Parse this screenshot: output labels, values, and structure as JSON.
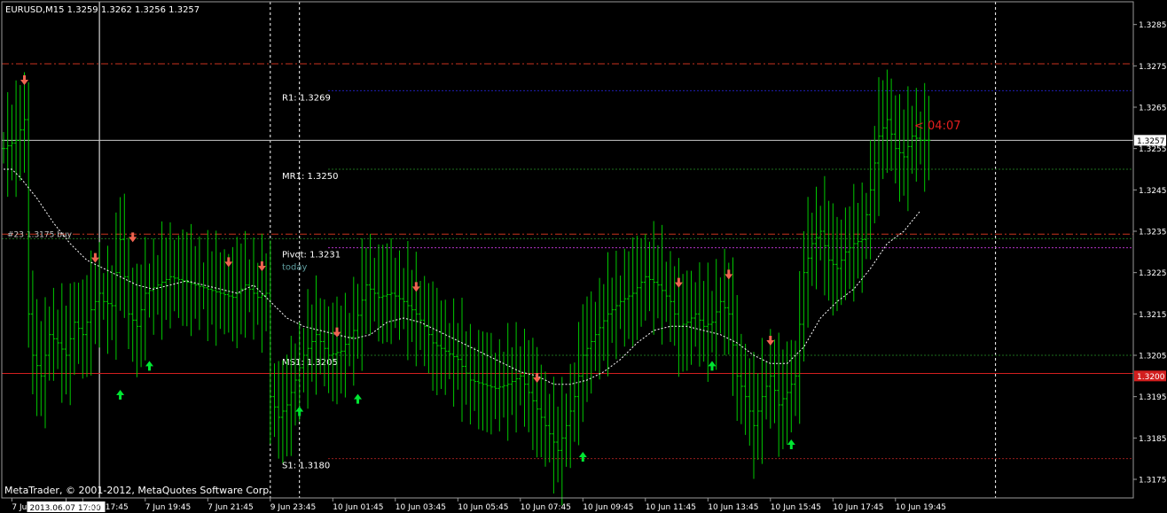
{
  "header": {
    "symbol_info": "EURUSD,M15  1.3259 1.3262 1.3256 1.3257"
  },
  "copyright": "MetaTrader, © 2001-2012, MetaQuotes Software Corp.",
  "timer": "< 04:07",
  "colors": {
    "background": "#000000",
    "bar": "#00c800",
    "ma": "#ffffff",
    "price_line": "#c8c8c8",
    "bid_label_bg": "#ffffff",
    "support_line": "#d21e1e",
    "resistance_dashdot": "#c8321e",
    "pivot_dot": "#b432c8",
    "green_dot": "#1e6e1e",
    "r1_dot": "#1e1eb4",
    "s1_dot": "#961e1e",
    "arrow_up": "#00e632",
    "arrow_down": "#f06450",
    "timer_text": "#e61e1e",
    "label_text": "#ffffff",
    "today_text": "#5f9ea0",
    "axis_text": "#ffffff"
  },
  "chart_data": {
    "type": "bar",
    "symbol": "EURUSD",
    "timeframe": "M15",
    "ylim": [
      1.31705,
      1.32905
    ],
    "y_ticks": [
      "1.3285",
      "1.3275",
      "1.3265",
      "1.3255",
      "1.3245",
      "1.3235",
      "1.3225",
      "1.3215",
      "1.3205",
      "1.3195",
      "1.3185",
      "1.3175"
    ],
    "current_price": "1.3257",
    "price_marker": "1.3200",
    "x_labels": [
      {
        "text": "7 Jun 2013",
        "i": 2
      },
      {
        "text": "2013.06.07 17:00",
        "i": 15,
        "highlight": true
      },
      {
        "text": "7 Jun 17:45",
        "i": 19
      },
      {
        "text": "7 Jun 19:45",
        "i": 34
      },
      {
        "text": "7 Jun 21:45",
        "i": 49
      },
      {
        "text": "9 Jun 23:45",
        "i": 64
      },
      {
        "text": "10 Jun 01:45",
        "i": 79
      },
      {
        "text": "10 Jun 03:45",
        "i": 94
      },
      {
        "text": "10 Jun 05:45",
        "i": 109
      },
      {
        "text": "10 Jun 07:45",
        "i": 124
      },
      {
        "text": "10 Jun 09:45",
        "i": 139
      },
      {
        "text": "10 Jun 11:45",
        "i": 154
      },
      {
        "text": "10 Jun 13:45",
        "i": 169
      },
      {
        "text": "10 Jun 15:45",
        "i": 184
      },
      {
        "text": "10 Jun 17:45",
        "i": 199
      },
      {
        "text": "10 Jun 19:45",
        "i": 214
      }
    ],
    "levels": [
      {
        "name": "R1",
        "text": "R1: 1.3269",
        "price": 1.3269,
        "style": "dot",
        "color": "#1e1eb4"
      },
      {
        "name": "MR1",
        "text": "MR1: 1.3250",
        "price": 1.325,
        "style": "dot",
        "color": "#1e6e1e"
      },
      {
        "name": "Pivot",
        "text": "Pivot: 1.3231",
        "price": 1.3231,
        "style": "dot",
        "color": "#b432c8"
      },
      {
        "name": "MS1",
        "text": "MS1: 1.3205",
        "price": 1.3205,
        "style": "dot",
        "color": "#1e6e1e"
      },
      {
        "name": "S1",
        "text": "S1: 1.3180",
        "price": 1.318,
        "style": "dot",
        "color": "#961e1e"
      }
    ],
    "today_label": "today",
    "hlines": [
      {
        "price": 1.32755,
        "style": "dashdot",
        "color": "#c8321e"
      },
      {
        "price": 1.32343,
        "style": "dashdot",
        "color": "#c8321e"
      },
      {
        "price": 1.32332,
        "style": "dot",
        "color": "#1e6e1e"
      },
      {
        "price": 1.32006,
        "style": "solid",
        "color": "#d21e1e"
      }
    ],
    "order_label": "#23 1.3175 buy",
    "vlines": [
      {
        "i": 23,
        "style": "solid"
      },
      {
        "i": 64,
        "style": "dash"
      },
      {
        "i": 71,
        "style": "dash"
      },
      {
        "i": 238,
        "style": "dash"
      }
    ],
    "arrows_down": [
      {
        "i": 5,
        "price": 1.3271
      },
      {
        "i": 22,
        "price": 1.3228
      },
      {
        "i": 31,
        "price": 1.3233
      },
      {
        "i": 54,
        "price": 1.3227
      },
      {
        "i": 62,
        "price": 1.3226
      },
      {
        "i": 80,
        "price": 1.321
      },
      {
        "i": 99,
        "price": 1.3221
      },
      {
        "i": 128,
        "price": 1.3199
      },
      {
        "i": 162,
        "price": 1.3222
      },
      {
        "i": 174,
        "price": 1.3224
      },
      {
        "i": 184,
        "price": 1.3208
      }
    ],
    "arrows_up": [
      {
        "i": 28,
        "price": 1.3196
      },
      {
        "i": 35,
        "price": 1.3203
      },
      {
        "i": 71,
        "price": 1.3192
      },
      {
        "i": 85,
        "price": 1.3195
      },
      {
        "i": 139,
        "price": 1.3181
      },
      {
        "i": 170,
        "price": 1.3203
      },
      {
        "i": 189,
        "price": 1.3184
      }
    ],
    "ma_anchors": [
      [
        0,
        1.325
      ],
      [
        2,
        1.325
      ],
      [
        4,
        1.3248
      ],
      [
        8,
        1.3243
      ],
      [
        12,
        1.3237
      ],
      [
        16,
        1.3232
      ],
      [
        20,
        1.3228
      ],
      [
        24,
        1.3226
      ],
      [
        28,
        1.3224
      ],
      [
        32,
        1.3222
      ],
      [
        36,
        1.3221
      ],
      [
        40,
        1.3222
      ],
      [
        44,
        1.3223
      ],
      [
        48,
        1.3222
      ],
      [
        52,
        1.3221
      ],
      [
        56,
        1.322
      ],
      [
        60,
        1.3222
      ],
      [
        64,
        1.3218
      ],
      [
        68,
        1.3214
      ],
      [
        72,
        1.3212
      ],
      [
        76,
        1.3211
      ],
      [
        80,
        1.321
      ],
      [
        84,
        1.3209
      ],
      [
        88,
        1.321
      ],
      [
        92,
        1.3213
      ],
      [
        96,
        1.3214
      ],
      [
        100,
        1.3213
      ],
      [
        104,
        1.3211
      ],
      [
        108,
        1.3209
      ],
      [
        112,
        1.3207
      ],
      [
        116,
        1.3205
      ],
      [
        120,
        1.3203
      ],
      [
        124,
        1.3201
      ],
      [
        128,
        1.32
      ],
      [
        132,
        1.3198
      ],
      [
        136,
        1.3198
      ],
      [
        140,
        1.3199
      ],
      [
        144,
        1.3201
      ],
      [
        148,
        1.3204
      ],
      [
        152,
        1.3208
      ],
      [
        156,
        1.3211
      ],
      [
        160,
        1.3212
      ],
      [
        164,
        1.3212
      ],
      [
        168,
        1.3211
      ],
      [
        172,
        1.321
      ],
      [
        176,
        1.3208
      ],
      [
        180,
        1.3205
      ],
      [
        184,
        1.3203
      ],
      [
        188,
        1.3203
      ],
      [
        192,
        1.3207
      ],
      [
        196,
        1.3214
      ],
      [
        200,
        1.3218
      ],
      [
        204,
        1.3221
      ],
      [
        208,
        1.3226
      ],
      [
        212,
        1.3232
      ],
      [
        216,
        1.3235
      ],
      [
        220,
        1.324
      ]
    ],
    "bar_count": 223,
    "close_anchors": [
      [
        0,
        1.3255
      ],
      [
        3,
        1.3257
      ],
      [
        5,
        1.3262
      ],
      [
        6,
        1.3215
      ],
      [
        7,
        1.3205
      ],
      [
        9,
        1.32
      ],
      [
        11,
        1.321
      ],
      [
        13,
        1.3208
      ],
      [
        15,
        1.3205
      ],
      [
        17,
        1.3213
      ],
      [
        19,
        1.321
      ],
      [
        21,
        1.3216
      ],
      [
        23,
        1.322
      ],
      [
        24,
        1.3218
      ],
      [
        26,
        1.3217
      ],
      [
        28,
        1.3233
      ],
      [
        30,
        1.3215
      ],
      [
        32,
        1.3212
      ],
      [
        34,
        1.322
      ],
      [
        37,
        1.3222
      ],
      [
        40,
        1.3224
      ],
      [
        43,
        1.3223
      ],
      [
        46,
        1.3222
      ],
      [
        49,
        1.3221
      ],
      [
        52,
        1.322
      ],
      [
        55,
        1.3219
      ],
      [
        58,
        1.3222
      ],
      [
        61,
        1.3219
      ],
      [
        63,
        1.322
      ],
      [
        64,
        1.3195
      ],
      [
        66,
        1.319
      ],
      [
        68,
        1.3193
      ],
      [
        70,
        1.3199
      ],
      [
        72,
        1.3205
      ],
      [
        75,
        1.321
      ],
      [
        78,
        1.3205
      ],
      [
        81,
        1.3206
      ],
      [
        84,
        1.3211
      ],
      [
        87,
        1.3222
      ],
      [
        90,
        1.3219
      ],
      [
        93,
        1.322
      ],
      [
        96,
        1.3218
      ],
      [
        99,
        1.3215
      ],
      [
        101,
        1.3212
      ],
      [
        103,
        1.3208
      ],
      [
        106,
        1.3206
      ],
      [
        109,
        1.3204
      ],
      [
        112,
        1.3199
      ],
      [
        115,
        1.3198
      ],
      [
        118,
        1.3197
      ],
      [
        121,
        1.3198
      ],
      [
        124,
        1.32
      ],
      [
        127,
        1.3194
      ],
      [
        130,
        1.3188
      ],
      [
        133,
        1.3182
      ],
      [
        135,
        1.3188
      ],
      [
        137,
        1.3195
      ],
      [
        139,
        1.3205
      ],
      [
        142,
        1.321
      ],
      [
        145,
        1.3215
      ],
      [
        148,
        1.3218
      ],
      [
        151,
        1.322
      ],
      [
        154,
        1.3224
      ],
      [
        157,
        1.3222
      ],
      [
        160,
        1.3218
      ],
      [
        162,
        1.3212
      ],
      [
        164,
        1.3213
      ],
      [
        166,
        1.3215
      ],
      [
        168,
        1.3212
      ],
      [
        170,
        1.3213
      ],
      [
        172,
        1.3218
      ],
      [
        174,
        1.3215
      ],
      [
        176,
        1.32
      ],
      [
        178,
        1.3195
      ],
      [
        180,
        1.3188
      ],
      [
        182,
        1.3195
      ],
      [
        184,
        1.32
      ],
      [
        186,
        1.3193
      ],
      [
        188,
        1.3196
      ],
      [
        190,
        1.32
      ],
      [
        192,
        1.3225
      ],
      [
        194,
        1.3232
      ],
      [
        196,
        1.3235
      ],
      [
        198,
        1.3228
      ],
      [
        200,
        1.3226
      ],
      [
        202,
        1.323
      ],
      [
        204,
        1.3232
      ],
      [
        206,
        1.3233
      ],
      [
        208,
        1.3245
      ],
      [
        210,
        1.3258
      ],
      [
        212,
        1.3262
      ],
      [
        214,
        1.3255
      ],
      [
        216,
        1.3253
      ],
      [
        218,
        1.3258
      ],
      [
        220,
        1.3257
      ]
    ]
  }
}
